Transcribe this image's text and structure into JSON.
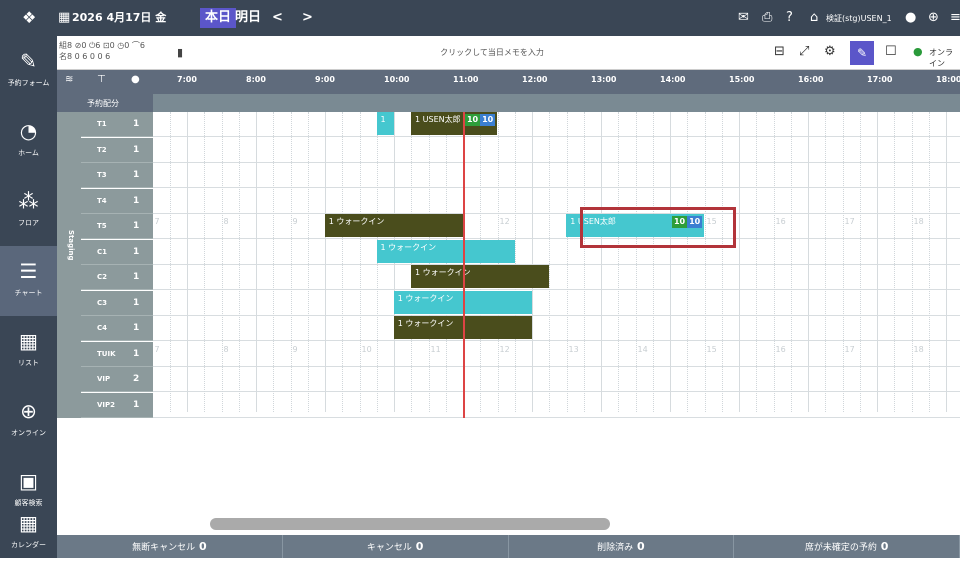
{
  "topbar": {
    "date": "2026 4月17日 金",
    "today": "本日",
    "tomorrow": "明日",
    "prev": "<",
    "next": ">",
    "account": "検証(stg)USEN_1"
  },
  "toolbar": {
    "stats_row1": "組8 ⊘0 ⏻6 ⊡0 ◷0 ⌒6",
    "stats_row2": "名8 0 6 0 0 6",
    "memo_placeholder": "クリックして当日メモを入力",
    "online": "オンライン"
  },
  "sidebar": [
    {
      "label": "予約フォーム",
      "icon": "form-edit-icon"
    },
    {
      "label": "ホーム",
      "icon": "home-gauge-icon"
    },
    {
      "label": "フロア",
      "icon": "floor-shapes-icon"
    },
    {
      "label": "チャート",
      "icon": "chart-icon",
      "active": true
    },
    {
      "label": "リスト",
      "icon": "list-grid-icon"
    },
    {
      "label": "オンライン",
      "icon": "globe-icon"
    },
    {
      "label": "顧客検索",
      "icon": "customer-card-icon"
    },
    {
      "label": "カレンダー",
      "icon": "calendar-icon"
    }
  ],
  "grid": {
    "header_sub": "予約配分",
    "group": "Staging",
    "hours": [
      "7:00",
      "8:00",
      "9:00",
      "10:00",
      "11:00",
      "12:00",
      "13:00",
      "14:00",
      "15:00",
      "16:00",
      "17:00",
      "18:00"
    ],
    "rows": [
      {
        "name": "T1",
        "cap": "1"
      },
      {
        "name": "T2",
        "cap": "1"
      },
      {
        "name": "T3",
        "cap": "1"
      },
      {
        "name": "T4",
        "cap": "1"
      },
      {
        "name": "T5",
        "cap": "1"
      },
      {
        "name": "C1",
        "cap": "1"
      },
      {
        "name": "C2",
        "cap": "1"
      },
      {
        "name": "C3",
        "cap": "1"
      },
      {
        "name": "C4",
        "cap": "1"
      },
      {
        "name": "TUIK",
        "cap": "1"
      },
      {
        "name": "VIP",
        "cap": "2"
      },
      {
        "name": "VIP2",
        "cap": "1"
      }
    ],
    "grid_hours": [
      "7",
      "8",
      "9",
      "10",
      "11",
      "12",
      "13",
      "14",
      "15",
      "16",
      "17",
      "18"
    ]
  },
  "reservations": [
    {
      "row": 0,
      "start": 10.0,
      "end": 10.25,
      "count": "1",
      "name": "",
      "color": "cyan"
    },
    {
      "row": 0,
      "start": 10.5,
      "end": 11.75,
      "count": "1",
      "name": "USEN太郎",
      "color": "dark",
      "badge1": "10",
      "badge2": "10"
    },
    {
      "row": 4,
      "start": 9.25,
      "end": 11.25,
      "count": "1",
      "name": "ウォークイン",
      "color": "dark"
    },
    {
      "row": 4,
      "start": 12.75,
      "end": 14.75,
      "count": "1",
      "name": "USEN太郎",
      "color": "cyan",
      "badge1": "10",
      "badge2": "10"
    },
    {
      "row": 5,
      "start": 10.0,
      "end": 12.0,
      "count": "1",
      "name": "ウォークイン",
      "color": "cyan"
    },
    {
      "row": 6,
      "start": 10.5,
      "end": 12.5,
      "count": "1",
      "name": "ウォークイン",
      "color": "dark"
    },
    {
      "row": 7,
      "start": 10.25,
      "end": 12.25,
      "count": "1",
      "name": "ウォークイン",
      "color": "cyan"
    },
    {
      "row": 8,
      "start": 10.25,
      "end": 12.25,
      "count": "1",
      "name": "ウォークイン",
      "color": "dark"
    }
  ],
  "now_time": 11.25,
  "bottombar": [
    {
      "label": "無断キャンセル",
      "count": "0"
    },
    {
      "label": "キャンセル",
      "count": "0"
    },
    {
      "label": "削除済み",
      "count": "0"
    },
    {
      "label": "席が未確定の予約",
      "count": "0"
    }
  ]
}
